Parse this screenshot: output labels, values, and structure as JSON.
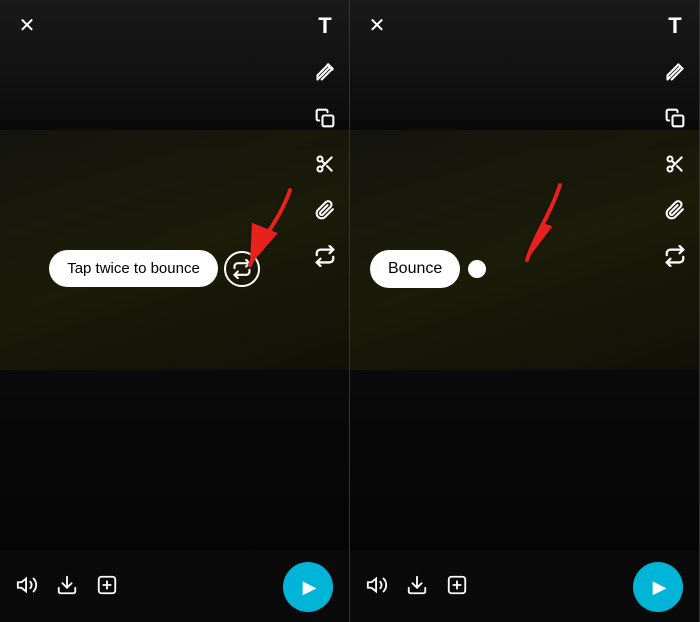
{
  "panels": [
    {
      "id": "left",
      "close_label": "✕",
      "tooltip": "Tap twice to bounce",
      "tools": [
        "T",
        "✏",
        "⧉",
        "✂",
        "🖇",
        "↺"
      ],
      "bottom_icons": [
        "🔈",
        "⬇",
        "⊞"
      ],
      "send_label": "send",
      "arrow_desc": "red-arrow pointing to bounce icon"
    },
    {
      "id": "right",
      "close_label": "✕",
      "bounce_label": "Bounce",
      "tools": [
        "T",
        "✏",
        "⧉",
        "✂",
        "🖇",
        "↺"
      ],
      "bottom_icons": [
        "🔈",
        "⬇",
        "⊞"
      ],
      "send_label": "send",
      "arrow_desc": "red-arrow pointing to white dot"
    }
  ],
  "colors": {
    "send_btn": "#29b6d2",
    "tooltip_bg": "#ffffff",
    "arrow": "#e8211d"
  }
}
